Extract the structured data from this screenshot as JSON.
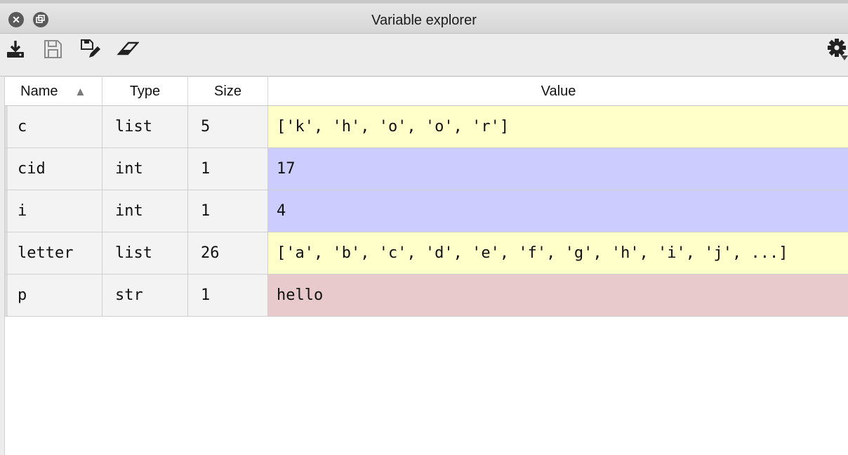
{
  "window": {
    "title": "Variable explorer"
  },
  "colors": {
    "list": "#ffffc9",
    "int": "#ccccff",
    "str": "#e8cacc"
  },
  "toolbar": {
    "icons": [
      "import-data-icon",
      "save-icon",
      "save-as-icon",
      "erase-icon",
      "gear-icon"
    ]
  },
  "table": {
    "headers": {
      "name": "Name",
      "sort": "▲",
      "type": "Type",
      "size": "Size",
      "value": "Value"
    },
    "rows": [
      {
        "name": "c",
        "type": "list",
        "size": "5",
        "value": "['k', 'h', 'o', 'o', 'r']"
      },
      {
        "name": "cid",
        "type": "int",
        "size": "1",
        "value": "17"
      },
      {
        "name": "i",
        "type": "int",
        "size": "1",
        "value": "4"
      },
      {
        "name": "letter",
        "type": "list",
        "size": "26",
        "value": "['a', 'b', 'c', 'd', 'e', 'f', 'g', 'h', 'i', 'j', ...]"
      },
      {
        "name": "p",
        "type": "str",
        "size": "1",
        "value": "hello"
      }
    ]
  }
}
